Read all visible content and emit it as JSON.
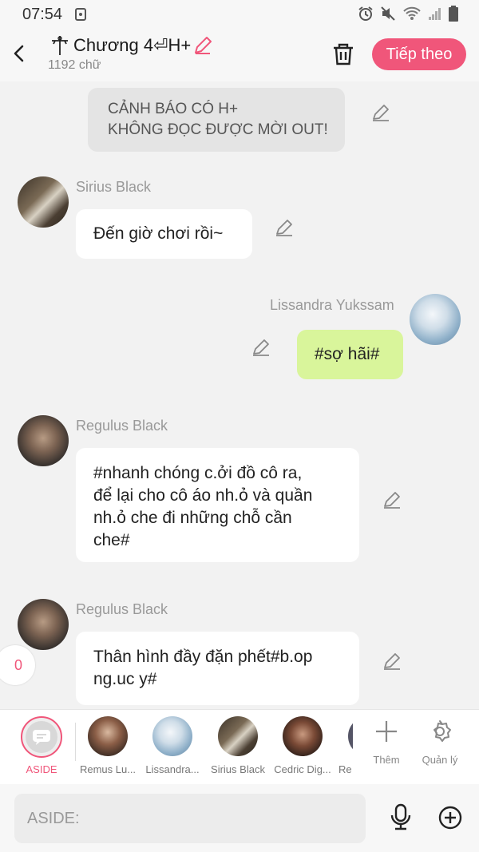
{
  "status_bar": {
    "time": "07:54"
  },
  "header": {
    "title": "Chương 4⏎H+",
    "word_count": "1192 chữ",
    "next_label": "Tiếp theo"
  },
  "messages": {
    "system": {
      "line1": "CẢNH BÁO CÓ H+",
      "line2": "KHÔNG ĐỌC ĐƯỢC MỜI OUT!"
    },
    "m1": {
      "name": "Sirius Black",
      "text": "Đến giờ chơi rồi~"
    },
    "m2": {
      "name": "Lissandra Yukssam",
      "text": "#sợ hãi#"
    },
    "m3": {
      "name": "Regulus Black",
      "line1": "#nhanh chóng c.ởi đồ cô ra,",
      "line2": "để lại cho cô áo nh.ỏ và quần",
      "line3": "nh.ỏ che đi những chỗ cần",
      "line4": "che#"
    },
    "m4": {
      "name": "Regulus Black",
      "line1": "Thân hình đầy đặn phết#b.op",
      "line2": "ng.uc y#"
    }
  },
  "side_counter": "0",
  "character_bar": {
    "aside_label": "ASIDE",
    "characters": [
      "Remus Lu...",
      "Lissandra...",
      "Sirius Black",
      "Cedric Dig...",
      "Re"
    ],
    "add_label": "Thêm",
    "manage_label": "Quản lý"
  },
  "composer": {
    "placeholder": "ASIDE:"
  },
  "colors": {
    "accent": "#f0567a",
    "self_bubble": "#d9f59b",
    "background": "#f2f2f2"
  }
}
